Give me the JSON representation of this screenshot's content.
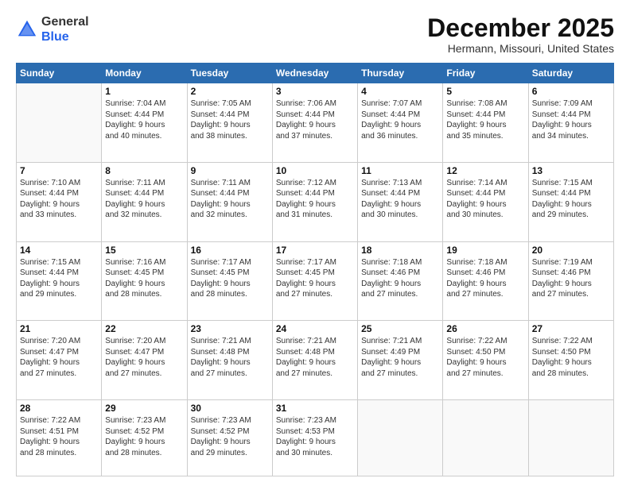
{
  "header": {
    "logo_general": "General",
    "logo_blue": "Blue",
    "month_title": "December 2025",
    "location": "Hermann, Missouri, United States"
  },
  "calendar": {
    "days_of_week": [
      "Sunday",
      "Monday",
      "Tuesday",
      "Wednesday",
      "Thursday",
      "Friday",
      "Saturday"
    ],
    "weeks": [
      [
        {
          "day": "",
          "content": ""
        },
        {
          "day": "1",
          "content": "Sunrise: 7:04 AM\nSunset: 4:44 PM\nDaylight: 9 hours\nand 40 minutes."
        },
        {
          "day": "2",
          "content": "Sunrise: 7:05 AM\nSunset: 4:44 PM\nDaylight: 9 hours\nand 38 minutes."
        },
        {
          "day": "3",
          "content": "Sunrise: 7:06 AM\nSunset: 4:44 PM\nDaylight: 9 hours\nand 37 minutes."
        },
        {
          "day": "4",
          "content": "Sunrise: 7:07 AM\nSunset: 4:44 PM\nDaylight: 9 hours\nand 36 minutes."
        },
        {
          "day": "5",
          "content": "Sunrise: 7:08 AM\nSunset: 4:44 PM\nDaylight: 9 hours\nand 35 minutes."
        },
        {
          "day": "6",
          "content": "Sunrise: 7:09 AM\nSunset: 4:44 PM\nDaylight: 9 hours\nand 34 minutes."
        }
      ],
      [
        {
          "day": "7",
          "content": "Sunrise: 7:10 AM\nSunset: 4:44 PM\nDaylight: 9 hours\nand 33 minutes."
        },
        {
          "day": "8",
          "content": "Sunrise: 7:11 AM\nSunset: 4:44 PM\nDaylight: 9 hours\nand 32 minutes."
        },
        {
          "day": "9",
          "content": "Sunrise: 7:11 AM\nSunset: 4:44 PM\nDaylight: 9 hours\nand 32 minutes."
        },
        {
          "day": "10",
          "content": "Sunrise: 7:12 AM\nSunset: 4:44 PM\nDaylight: 9 hours\nand 31 minutes."
        },
        {
          "day": "11",
          "content": "Sunrise: 7:13 AM\nSunset: 4:44 PM\nDaylight: 9 hours\nand 30 minutes."
        },
        {
          "day": "12",
          "content": "Sunrise: 7:14 AM\nSunset: 4:44 PM\nDaylight: 9 hours\nand 30 minutes."
        },
        {
          "day": "13",
          "content": "Sunrise: 7:15 AM\nSunset: 4:44 PM\nDaylight: 9 hours\nand 29 minutes."
        }
      ],
      [
        {
          "day": "14",
          "content": "Sunrise: 7:15 AM\nSunset: 4:44 PM\nDaylight: 9 hours\nand 29 minutes."
        },
        {
          "day": "15",
          "content": "Sunrise: 7:16 AM\nSunset: 4:45 PM\nDaylight: 9 hours\nand 28 minutes."
        },
        {
          "day": "16",
          "content": "Sunrise: 7:17 AM\nSunset: 4:45 PM\nDaylight: 9 hours\nand 28 minutes."
        },
        {
          "day": "17",
          "content": "Sunrise: 7:17 AM\nSunset: 4:45 PM\nDaylight: 9 hours\nand 27 minutes."
        },
        {
          "day": "18",
          "content": "Sunrise: 7:18 AM\nSunset: 4:46 PM\nDaylight: 9 hours\nand 27 minutes."
        },
        {
          "day": "19",
          "content": "Sunrise: 7:18 AM\nSunset: 4:46 PM\nDaylight: 9 hours\nand 27 minutes."
        },
        {
          "day": "20",
          "content": "Sunrise: 7:19 AM\nSunset: 4:46 PM\nDaylight: 9 hours\nand 27 minutes."
        }
      ],
      [
        {
          "day": "21",
          "content": "Sunrise: 7:20 AM\nSunset: 4:47 PM\nDaylight: 9 hours\nand 27 minutes."
        },
        {
          "day": "22",
          "content": "Sunrise: 7:20 AM\nSunset: 4:47 PM\nDaylight: 9 hours\nand 27 minutes."
        },
        {
          "day": "23",
          "content": "Sunrise: 7:21 AM\nSunset: 4:48 PM\nDaylight: 9 hours\nand 27 minutes."
        },
        {
          "day": "24",
          "content": "Sunrise: 7:21 AM\nSunset: 4:48 PM\nDaylight: 9 hours\nand 27 minutes."
        },
        {
          "day": "25",
          "content": "Sunrise: 7:21 AM\nSunset: 4:49 PM\nDaylight: 9 hours\nand 27 minutes."
        },
        {
          "day": "26",
          "content": "Sunrise: 7:22 AM\nSunset: 4:50 PM\nDaylight: 9 hours\nand 27 minutes."
        },
        {
          "day": "27",
          "content": "Sunrise: 7:22 AM\nSunset: 4:50 PM\nDaylight: 9 hours\nand 28 minutes."
        }
      ],
      [
        {
          "day": "28",
          "content": "Sunrise: 7:22 AM\nSunset: 4:51 PM\nDaylight: 9 hours\nand 28 minutes."
        },
        {
          "day": "29",
          "content": "Sunrise: 7:23 AM\nSunset: 4:52 PM\nDaylight: 9 hours\nand 28 minutes."
        },
        {
          "day": "30",
          "content": "Sunrise: 7:23 AM\nSunset: 4:52 PM\nDaylight: 9 hours\nand 29 minutes."
        },
        {
          "day": "31",
          "content": "Sunrise: 7:23 AM\nSunset: 4:53 PM\nDaylight: 9 hours\nand 30 minutes."
        },
        {
          "day": "",
          "content": ""
        },
        {
          "day": "",
          "content": ""
        },
        {
          "day": "",
          "content": ""
        }
      ]
    ]
  }
}
